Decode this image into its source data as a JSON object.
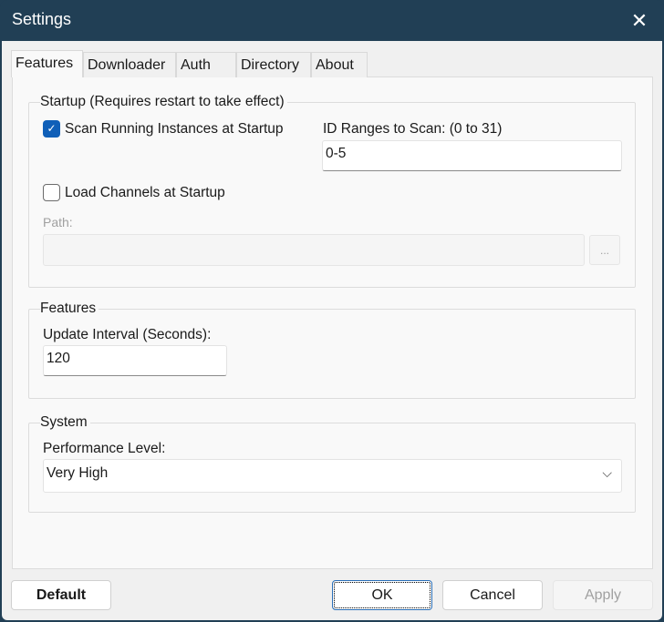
{
  "window": {
    "title": "Settings",
    "close_icon": "close-icon"
  },
  "tabs": [
    {
      "label": "Features",
      "selected": true
    },
    {
      "label": "Downloader"
    },
    {
      "label": "Auth"
    },
    {
      "label": "Directory"
    },
    {
      "label": "About"
    }
  ],
  "startup": {
    "legend": "Startup (Requires restart to take effect)",
    "scan_label": "Scan Running Instances at Startup",
    "scan_checked": true,
    "id_range_label": "ID Ranges to Scan: (0 to 31)",
    "id_range_value": "0-5",
    "load_channels_label": "Load Channels at Startup",
    "load_channels_checked": false,
    "path_label": "Path:",
    "path_value": "",
    "browse_label": "..."
  },
  "features": {
    "legend": "Features",
    "interval_label": "Update Interval (Seconds):",
    "interval_value": "120"
  },
  "system": {
    "legend": "System",
    "perf_label": "Performance Level:",
    "perf_value": "Very High"
  },
  "buttons": {
    "default": "Default",
    "ok": "OK",
    "cancel": "Cancel",
    "apply": "Apply"
  }
}
